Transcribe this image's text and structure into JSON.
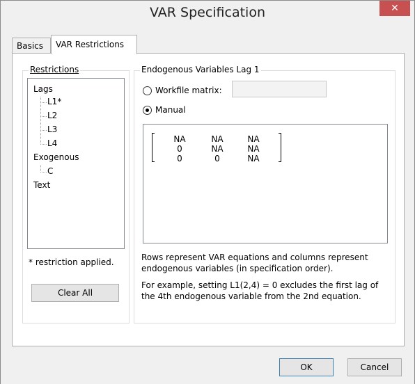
{
  "window": {
    "title": "VAR Specification",
    "close_glyph": "✕"
  },
  "tabs": [
    {
      "label": "Basics"
    },
    {
      "label": "VAR Restrictions"
    }
  ],
  "restrictions": {
    "group_label": "Restrictions",
    "tree": {
      "lags": "Lags",
      "lag_items": [
        "L1*",
        "L2",
        "L3",
        "L4"
      ],
      "exogenous": "Exogenous",
      "exo_items": [
        "C"
      ],
      "text": "Text"
    },
    "note": "* restriction applied.",
    "clear_all": "Clear All"
  },
  "endogenous": {
    "group_label": "Endogenous Variables Lag 1",
    "workfile_matrix_label": "Workfile matrix:",
    "workfile_matrix_value": "",
    "manual_label": "Manual",
    "selected": "manual",
    "matrix": [
      [
        "NA",
        "NA",
        "NA"
      ],
      [
        "0",
        "NA",
        "NA"
      ],
      [
        "0",
        "0",
        "NA"
      ]
    ],
    "help_line1": "Rows represent VAR equations and columns represent",
    "help_line2": "endogenous variables (in specification order).",
    "help_line3": "For example, setting L1(2,4) = 0 excludes the first lag of",
    "help_line4": "the 4th endogenous variable from the 2nd equation."
  },
  "footer": {
    "ok": "OK",
    "cancel": "Cancel"
  },
  "colors": {
    "close_button": "#c75050",
    "default_button_border": "#3c7fb1"
  }
}
